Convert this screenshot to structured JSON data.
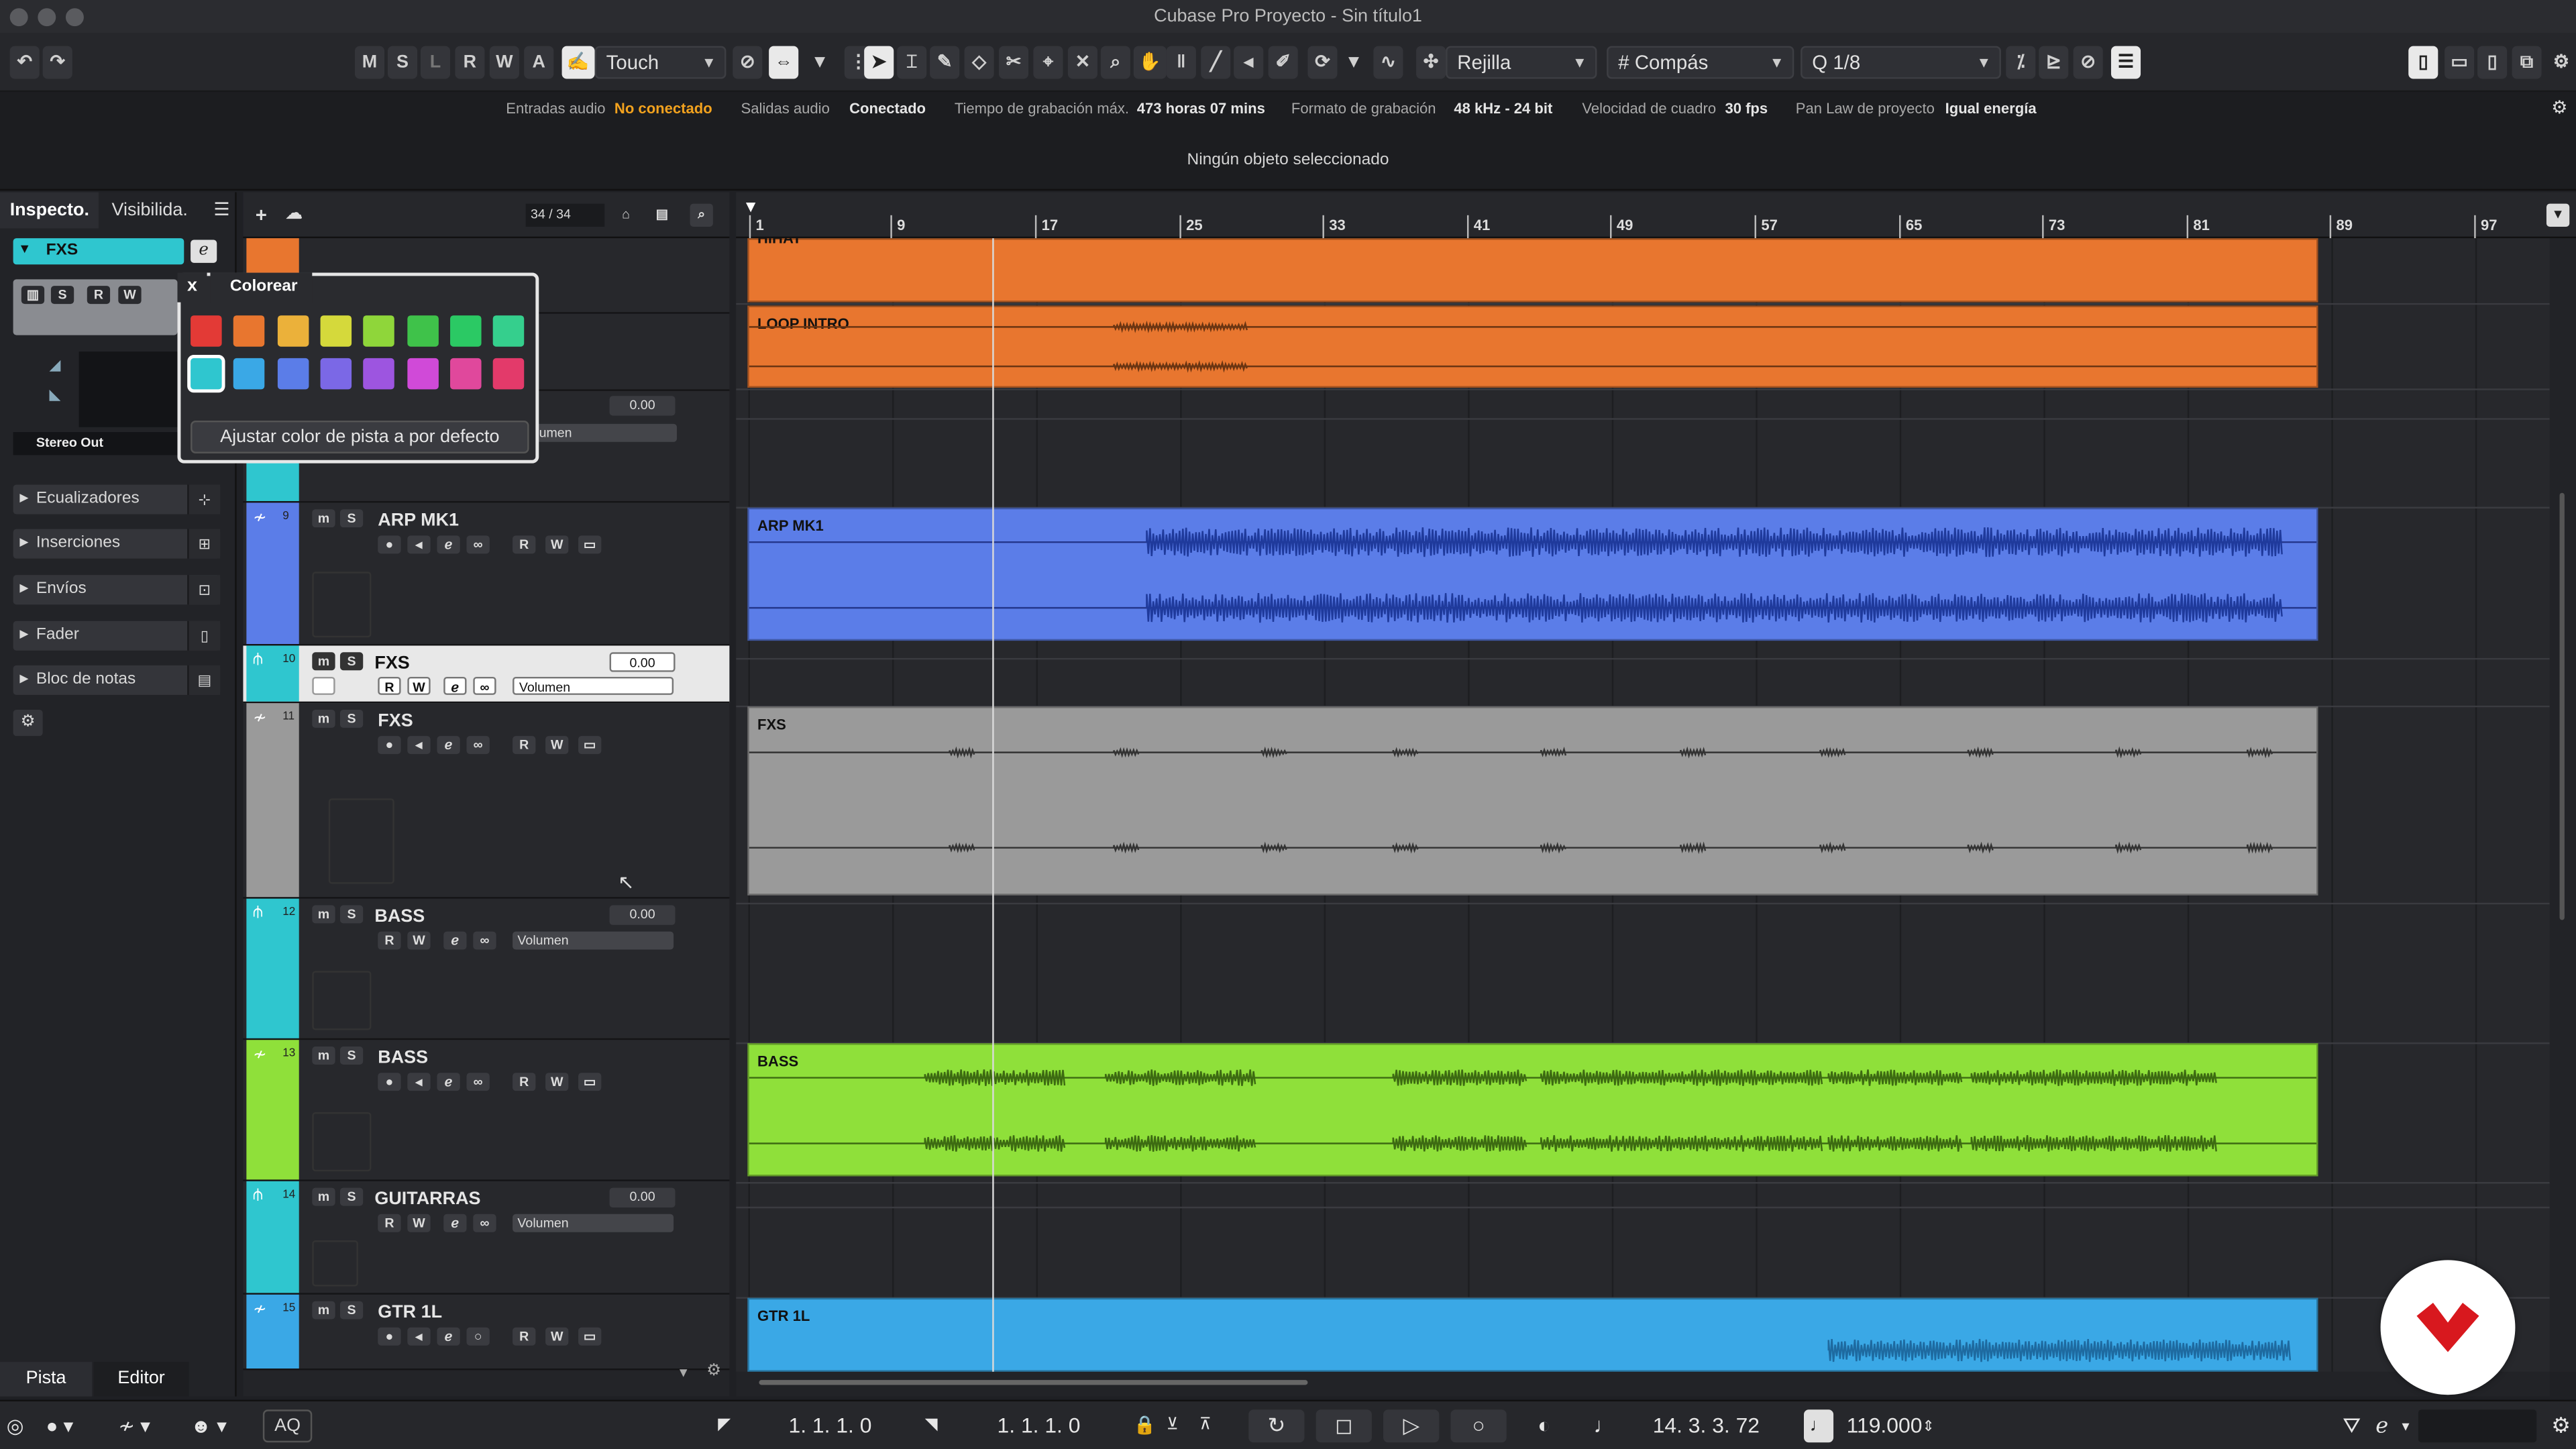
{
  "window": {
    "title": "Cubase Pro Proyecto - Sin título1"
  },
  "toolbar": {
    "mode_buttons": [
      "M",
      "S",
      "L",
      "R",
      "W",
      "A"
    ],
    "automation_mode": "Touch",
    "snap_type": "Rejilla",
    "grid_type": "Compás",
    "quantize": "1/8"
  },
  "status": {
    "audio_inputs_label": "Entradas audio",
    "audio_inputs_value": "No conectado",
    "audio_outputs_label": "Salidas audio",
    "audio_outputs_value": "Conectado",
    "rec_time_label": "Tiempo de grabación máx.",
    "rec_time_value": "473 horas 07 mins",
    "rec_format_label": "Formato de grabación",
    "rec_format_value": "48 kHz - 24 bit",
    "frame_rate_label": "Velocidad de cuadro",
    "frame_rate_value": "30 fps",
    "pan_law_label": "Pan Law de proyecto",
    "pan_law_value": "Igual energía"
  },
  "info_line": "Ningún objeto seleccionado",
  "inspector": {
    "tabs": [
      "Inspecto.",
      "Visibilida."
    ],
    "track_name": "FXS",
    "output": "Stereo Out",
    "sections": [
      "Ecualizadores",
      "Inserciones",
      "Envíos",
      "Fader",
      "Bloc de notas"
    ],
    "bottom_tabs": [
      "Pista",
      "Editor"
    ]
  },
  "tracklist": {
    "count": "34 / 34",
    "tracks": [
      {
        "num": "9",
        "name": "ARP MK1",
        "color": "#5b7de8"
      },
      {
        "num": "10",
        "name": "FXS",
        "color": "#ececec",
        "volume": "0.00",
        "vol_label": "Volumen"
      },
      {
        "num": "11",
        "name": "FXS",
        "color": "#9a9a9a"
      },
      {
        "num": "12",
        "name": "BASS",
        "color": "#2fc6cf",
        "volume": "0.00",
        "vol_label": "Volumen"
      },
      {
        "num": "13",
        "name": "BASS",
        "color": "#8fe03a"
      },
      {
        "num": "14",
        "name": "GUITARRAS",
        "color": "#2fc6cf",
        "volume": "0.00",
        "vol_label": "Volumen"
      },
      {
        "num": "15",
        "name": "GTR 1L",
        "color": "#3aa8e6"
      }
    ],
    "top_volume": "0.00",
    "top_vol_label": "Volumen"
  },
  "ruler": {
    "marks": [
      "1",
      "9",
      "17",
      "25",
      "33",
      "41",
      "49",
      "57",
      "65",
      "73",
      "81",
      "89",
      "97"
    ]
  },
  "clips": {
    "hihat": "HIHAT",
    "loop_intro": "LOOP INTRO",
    "arp": "ARP MK1",
    "fxs": "FXS",
    "bass": "BASS",
    "gtr": "GTR 1L"
  },
  "colorize_popup": {
    "close": "x",
    "title": "Colorear",
    "swatches": [
      "#e33a36",
      "#e8762f",
      "#ebb13a",
      "#d5d93b",
      "#8fd63a",
      "#3fc24a",
      "#2bc964",
      "#35cf8d",
      "#2fc6cf",
      "#3aa8e6",
      "#5b7de8",
      "#7b68e6",
      "#9d55e0",
      "#d04ad8",
      "#e0489c",
      "#e33a6a"
    ],
    "reset_button": "Ajustar color de pista a por defecto"
  },
  "transport": {
    "left_locator": "1. 1. 1.   0",
    "right_locator": "1. 1. 1.   0",
    "position": "14. 3. 3.  72",
    "tempo": "119.000",
    "aq": "AQ"
  },
  "colors": {
    "accent_orange": "#e8762f",
    "warn": "#f2a21e"
  }
}
